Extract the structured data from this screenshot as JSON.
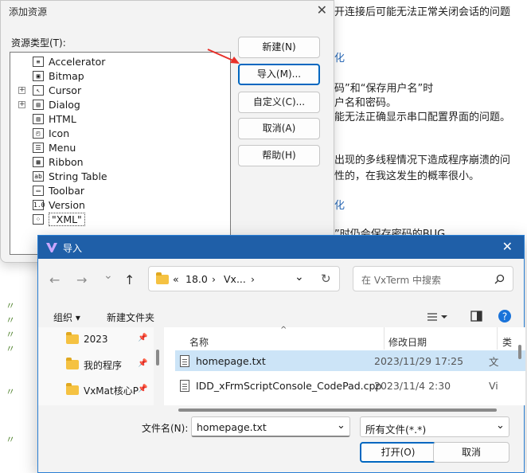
{
  "background": {
    "lines": [
      {
        "text": "开连接后可能无法正常关闭会话的问题",
        "cls": ""
      },
      {
        "text": "化",
        "cls": "bg-head"
      },
      {
        "text": "码”和“保存用户名”时",
        "cls": ""
      },
      {
        "text": "户名和密码。",
        "cls": ""
      },
      {
        "text": "能无法正确显示串口配置界面的问题。",
        "cls": ""
      },
      {
        "text": "出现的多线程情况下造成程序崩溃的问",
        "cls": ""
      },
      {
        "text": "性的，在我这发生的概率很小。",
        "cls": ""
      },
      {
        "text": "化",
        "cls": "bg-head"
      },
      {
        "text": "”时仍会保存密码的BUG",
        "cls": ""
      }
    ]
  },
  "add_dialog": {
    "title": "添加资源",
    "close": "✕",
    "type_label": "资源类型(T):",
    "tree": [
      {
        "label": "Accelerator",
        "glyph": "≡",
        "expand": false
      },
      {
        "label": "Bitmap",
        "glyph": "▣",
        "expand": false
      },
      {
        "label": "Cursor",
        "glyph": "↖",
        "expand": true
      },
      {
        "label": "Dialog",
        "glyph": "▤",
        "expand": true
      },
      {
        "label": "HTML",
        "glyph": "▥",
        "expand": false
      },
      {
        "label": "Icon",
        "glyph": "◰",
        "expand": false
      },
      {
        "label": "Menu",
        "glyph": "☰",
        "expand": false
      },
      {
        "label": "Ribbon",
        "glyph": "▦",
        "expand": false
      },
      {
        "label": "String Table",
        "glyph": "ab",
        "expand": false
      },
      {
        "label": "Toolbar",
        "glyph": "▭",
        "expand": false
      },
      {
        "label": "Version",
        "glyph": "1.0",
        "expand": false
      },
      {
        "label": "\"XML\"",
        "glyph": "⁘",
        "expand": false,
        "selected": true
      }
    ],
    "buttons": {
      "new": "新建(N)",
      "import": "导入(M)...",
      "custom": "自定义(C)...",
      "cancel": "取消(A)",
      "help": "帮助(H)"
    }
  },
  "import_dialog": {
    "title": "导入",
    "close": "✕",
    "nav": {
      "back": "←",
      "forward": "→",
      "down": "⌄",
      "up": "↑",
      "refresh": "↻"
    },
    "address": {
      "prefix": "«",
      "seg1": "18.0",
      "sep": "›",
      "seg2": "Vx...",
      "chevron": "⌄"
    },
    "search_placeholder": "在 VxTerm 中搜索",
    "toolbar": {
      "organize": "组织 ▾",
      "new_folder": "新建文件夹"
    },
    "left_items": [
      {
        "label": "2023",
        "pin": "📌"
      },
      {
        "label": "我的程序",
        "pin": "📌"
      },
      {
        "label": "VxMat核心P",
        "pin": "📌"
      }
    ],
    "columns": {
      "name": "名称",
      "date": "修改日期",
      "type": "类"
    },
    "files": [
      {
        "name": "homepage.txt",
        "date": "2023/11/29 17:25",
        "type": "文",
        "selected": true
      },
      {
        "name": "IDD_xFrmScriptConsole_CodePad.cpp",
        "date": "2023/11/4 2:30",
        "type": "Vi",
        "selected": false
      }
    ],
    "filename_label": "文件名(N):",
    "filename_value": "homepage.txt",
    "filter_value": "所有文件(*.*)",
    "open_button": "打开(O)",
    "cancel_button": "取消"
  },
  "colors": {
    "accent": "#0067c0",
    "title_bar": "#1f5fa8",
    "selection": "#cce4f7",
    "arrow": "#e8302a"
  }
}
